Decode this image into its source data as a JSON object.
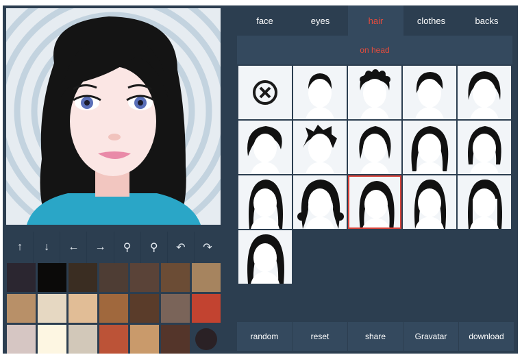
{
  "toolbar": {
    "tools": [
      {
        "name": "move-up",
        "glyph": "↑"
      },
      {
        "name": "move-down",
        "glyph": "↓"
      },
      {
        "name": "move-left",
        "glyph": "←"
      },
      {
        "name": "move-right",
        "glyph": "→"
      },
      {
        "name": "zoom-out",
        "glyph": "⚲"
      },
      {
        "name": "zoom-in",
        "glyph": "⚲"
      },
      {
        "name": "undo",
        "glyph": "↶"
      },
      {
        "name": "redo",
        "glyph": "↷"
      }
    ]
  },
  "colors": {
    "app_bg": "#2c3e50",
    "panel_bg": "#34495e",
    "accent": "#e74c3c",
    "swatches": [
      "#2b2630",
      "#0b0a09",
      "#3a2d22",
      "#4e3d34",
      "#5a4338",
      "#6b4c35",
      "#a6845f",
      "#b89068",
      "#e6d8c2",
      "#e1bd96",
      "#a0683d",
      "#5a3c2a",
      "#7a6459",
      "#c24330",
      "#d6c6c3",
      "#fdf6e2",
      "#d2c8b9",
      "#bc5337",
      "#c99a6b",
      "#54352a",
      "#2a2125"
    ]
  },
  "tabs": [
    {
      "label": "face",
      "active": false
    },
    {
      "label": "eyes",
      "active": false
    },
    {
      "label": "hair",
      "active": true
    },
    {
      "label": "clothes",
      "active": false
    },
    {
      "label": "backs",
      "active": false
    }
  ],
  "subtab": {
    "label": "on head"
  },
  "hair_options": [
    {
      "icon": "none-icon"
    },
    {
      "icon": "hair-short-crop-icon"
    },
    {
      "icon": "hair-curly-short-icon"
    },
    {
      "icon": "hair-side-part-icon"
    },
    {
      "icon": "hair-bob-icon"
    },
    {
      "icon": "hair-wavy-short-icon"
    },
    {
      "icon": "hair-spiky-icon"
    },
    {
      "icon": "hair-shaggy-icon"
    },
    {
      "icon": "hair-long-straight-icon"
    },
    {
      "icon": "hair-medium-bob-icon"
    },
    {
      "icon": "hair-long-smooth-icon"
    },
    {
      "icon": "hair-long-curly-icon"
    },
    {
      "icon": "hair-long-wavy-icon"
    },
    {
      "icon": "hair-long-sleek-icon"
    },
    {
      "icon": "hair-long-bangs-icon"
    },
    {
      "icon": "hair-long-textured-icon"
    }
  ],
  "selected_index": 12,
  "actions": [
    {
      "label": "random"
    },
    {
      "label": "reset"
    },
    {
      "label": "share"
    },
    {
      "label": "Gravatar"
    },
    {
      "label": "download"
    }
  ]
}
